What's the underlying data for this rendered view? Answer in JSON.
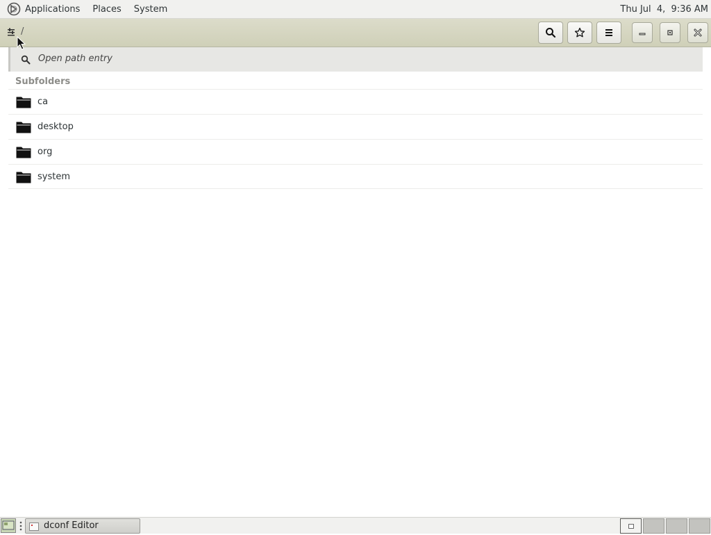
{
  "top_panel": {
    "menus": [
      "Applications",
      "Places",
      "System"
    ],
    "clock": "Thu Jul  4,  9:36 AM"
  },
  "headerbar": {
    "path": "/",
    "icons": [
      "search-icon",
      "bookmark-star-icon",
      "hamburger-menu-icon",
      "minimize-icon",
      "maximize-icon",
      "close-icon"
    ]
  },
  "search": {
    "placeholder": "Open path entry"
  },
  "content": {
    "section_title": "Subfolders",
    "folders": [
      {
        "label": "ca"
      },
      {
        "label": "desktop"
      },
      {
        "label": "org"
      },
      {
        "label": "system"
      }
    ]
  },
  "taskbar": {
    "task_label": "dconf Editor"
  }
}
